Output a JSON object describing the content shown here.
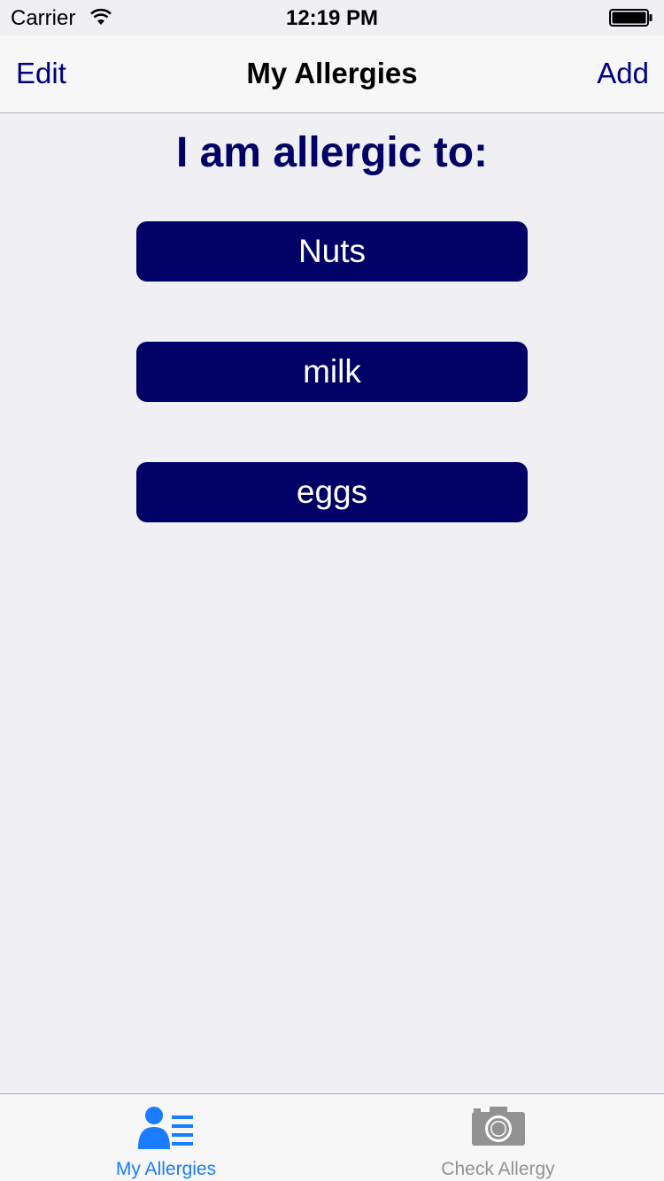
{
  "status_bar": {
    "carrier": "Carrier",
    "time": "12:19 PM",
    "icons": [
      "wifi-icon",
      "battery-icon"
    ]
  },
  "nav_bar": {
    "left_label": "Edit",
    "title": "My Allergies",
    "right_label": "Add"
  },
  "content": {
    "heading": "I am allergic to:",
    "allergies": [
      "Nuts",
      "milk",
      "eggs"
    ]
  },
  "tab_bar": {
    "tabs": [
      {
        "label": "My Allergies",
        "icon": "contacts-list-icon",
        "selected": true
      },
      {
        "label": "Check Allergy",
        "icon": "camera-icon",
        "selected": false
      }
    ]
  },
  "colors": {
    "accent": "#000066",
    "nav_text": "#000080",
    "tab_selected": "#1a7cff",
    "tab_unselected": "#929292",
    "background": "#efeff4"
  }
}
